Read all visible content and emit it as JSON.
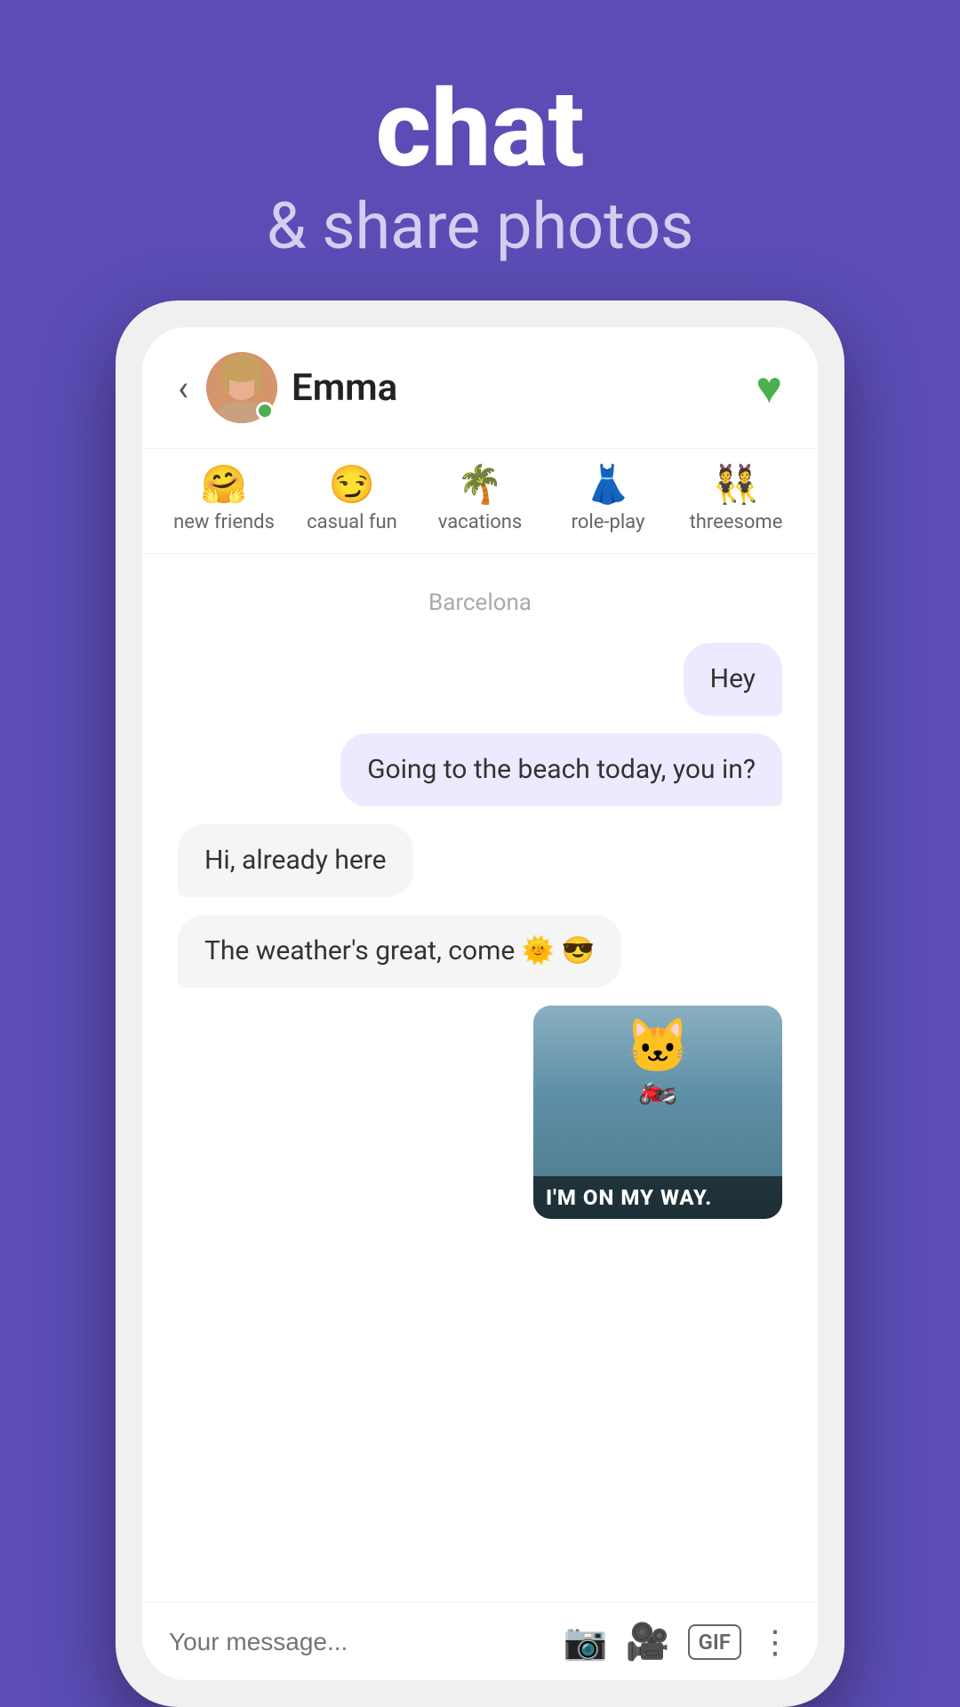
{
  "header": {
    "title": "chat",
    "subtitle": "& share photos"
  },
  "contact": {
    "name": "Emma",
    "online": true,
    "avatar_emoji": "👱‍♀️"
  },
  "interests": [
    {
      "id": "new-friends",
      "icon": "🤗",
      "label": "new friends"
    },
    {
      "id": "casual-fun",
      "icon": "😏",
      "label": "casual fun"
    },
    {
      "id": "vacations",
      "icon": "🌴",
      "label": "vacations"
    },
    {
      "id": "role-play",
      "icon": "👗",
      "label": "role-play"
    },
    {
      "id": "threesome",
      "icon": "👯",
      "label": "threesome"
    }
  ],
  "location_tag": "Barcelona",
  "messages": [
    {
      "id": "msg1",
      "text": "Hey",
      "side": "right"
    },
    {
      "id": "msg2",
      "text": "Going to the beach today, you in?",
      "side": "right"
    },
    {
      "id": "msg3",
      "text": "Hi, already here",
      "side": "left"
    },
    {
      "id": "msg4",
      "text": "The weather's great, come 🌞 😎",
      "side": "left"
    }
  ],
  "gif": {
    "caption": "I'M ON MY WAY."
  },
  "input": {
    "placeholder": "Your message..."
  },
  "back_label": "‹",
  "heart_icon": "♥",
  "camera_icon": "📷",
  "video_icon": "🎥",
  "gif_label": "GIF",
  "more_icon": "⋮"
}
